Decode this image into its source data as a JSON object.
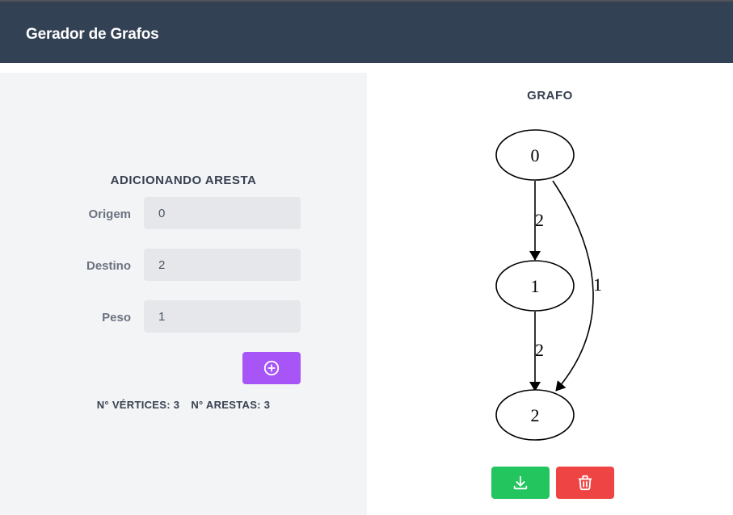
{
  "header": {
    "title": "Gerador de Grafos"
  },
  "form": {
    "title": "ADICIONANDO ARESTA",
    "origin": {
      "label": "Origem",
      "value": "0"
    },
    "destination": {
      "label": "Destino",
      "value": "2"
    },
    "weight": {
      "label": "Peso",
      "value": "1"
    },
    "add_icon": "plus-circle-icon"
  },
  "stats": {
    "vertices_text": "N° VÉRTICES: 3",
    "edges_text": "N° ARESTAS: 3"
  },
  "graph": {
    "title": "GRAFO",
    "nodes": [
      "0",
      "1",
      "2"
    ],
    "edges": [
      {
        "from": "0",
        "to": "1",
        "weight": "2"
      },
      {
        "from": "1",
        "to": "2",
        "weight": "2"
      },
      {
        "from": "0",
        "to": "2",
        "weight": "1"
      }
    ]
  },
  "actions": {
    "download_icon": "download-icon",
    "delete_icon": "trash-icon"
  },
  "colors": {
    "navbar": "#334155",
    "panel": "#f3f4f6",
    "add": "#a855f7",
    "download": "#22c55e",
    "delete": "#ef4444"
  }
}
